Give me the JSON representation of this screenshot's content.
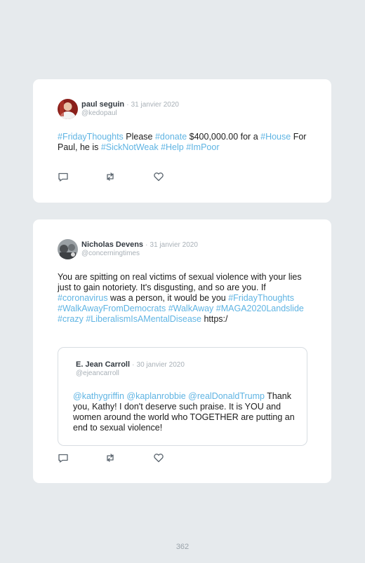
{
  "tweets": [
    {
      "author": "paul seguin",
      "separator": "·",
      "date": "31 janvier 2020",
      "handle": "@kedopaul",
      "segments": [
        {
          "t": "#FridayThoughts",
          "tag": true
        },
        {
          "t": " Please ",
          "tag": false
        },
        {
          "t": "#donate",
          "tag": true
        },
        {
          "t": " $400,000.00 for a ",
          "tag": false
        },
        {
          "t": "#House",
          "tag": true
        },
        {
          "t": " For Paul, he is ",
          "tag": false
        },
        {
          "t": "#SickNotWeak",
          "tag": true
        },
        {
          "t": " ",
          "tag": false
        },
        {
          "t": "#Help",
          "tag": true
        },
        {
          "t": " ",
          "tag": false
        },
        {
          "t": "#ImPoor",
          "tag": true
        }
      ]
    },
    {
      "author": "Nicholas Devens",
      "separator": "·",
      "date": "31 janvier 2020",
      "handle": "@concerningtimes",
      "segments": [
        {
          "t": "You are spitting on real victims of sexual violence with your lies just to gain notoriety. It's disgusting, and so are you. If ",
          "tag": false
        },
        {
          "t": "#coronavirus",
          "tag": true
        },
        {
          "t": " was a person, it would be you ",
          "tag": false
        },
        {
          "t": "#FridayThoughts",
          "tag": true
        },
        {
          "t": " ",
          "tag": false
        },
        {
          "t": "#WalkAwayFromDemocrats",
          "tag": true
        },
        {
          "t": " ",
          "tag": false
        },
        {
          "t": "#WalkAway",
          "tag": true
        },
        {
          "t": " ",
          "tag": false
        },
        {
          "t": "#MAGA2020Landslide",
          "tag": true
        },
        {
          "t": " ",
          "tag": false
        },
        {
          "t": "#crazy",
          "tag": true
        },
        {
          "t": " ",
          "tag": false
        },
        {
          "t": "#LiberalismIsAMentalDisease",
          "tag": true
        },
        {
          "t": " https:/",
          "tag": false
        }
      ],
      "quote": {
        "author": "E. Jean Carroll",
        "separator": "·",
        "date": "30 janvier 2020",
        "handle": "@ejeancarroll",
        "segments": [
          {
            "t": "@kathygriffin",
            "tag": true
          },
          {
            "t": " ",
            "tag": false
          },
          {
            "t": "@kaplanrobbie",
            "tag": true
          },
          {
            "t": " ",
            "tag": false
          },
          {
            "t": "@realDonaldTrump",
            "tag": true
          },
          {
            "t": " Thank you, Kathy! I don't deserve such praise. It is YOU and women around the world who TOGETHER are putting an end to sexual violence!",
            "tag": false
          }
        ]
      }
    }
  ],
  "icons": [
    "reply-icon",
    "retweet-icon",
    "like-icon"
  ],
  "colors": {
    "hashtag": "#5fb4e3",
    "background": "#e6eaed",
    "muted": "#a8b0b7"
  },
  "page_number": "362"
}
